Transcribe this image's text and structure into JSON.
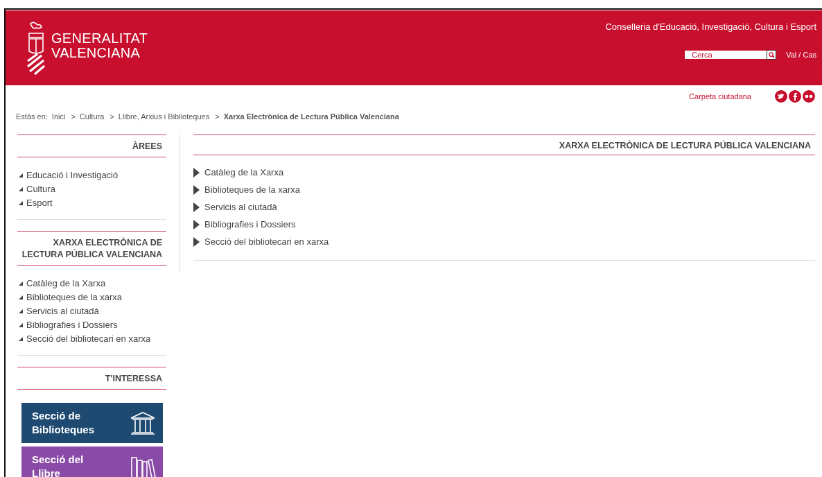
{
  "header": {
    "logo_line_1": "GENERALITAT",
    "logo_line_2": "VALENCIANA",
    "department": "Conselleria d'Educació, Investigació, Cultura i Esport",
    "search": {
      "placeholder": "Cerca"
    },
    "language": "Val / Cas"
  },
  "utility": {
    "link": "Carpeta ciutadana",
    "social": [
      {
        "kind": "twitter"
      },
      {
        "kind": "facebook"
      },
      {
        "kind": "flickr"
      }
    ]
  },
  "breadcrumb": {
    "label": "Estàs en:",
    "separator": ">",
    "items": [
      {
        "text": "Inici",
        "current": false
      },
      {
        "text": "Cultura",
        "current": false
      },
      {
        "text": "Llibre, Arxius i Biblioteques",
        "current": false
      },
      {
        "text": "Xarxa Electrònica de Lectura Pública Valenciana",
        "current": true
      }
    ]
  },
  "sidebar": {
    "sections": [
      {
        "title": "ÀREES",
        "items": [
          "Educació i Investigació",
          "Cultura",
          "Esport"
        ]
      },
      {
        "title": "XARXA ELECTRÒNICA DE LECTURA PÚBLICA VALENCIANA",
        "items": [
          "Catàleg de la Xarxa",
          "Biblioteques de la xarxa",
          "Servicis al ciutadà",
          "Bibliografies i Dossiers",
          "Secció del bibliotecari en xarxa"
        ]
      }
    ],
    "interest": {
      "title": "T'INTERESSA",
      "banners": [
        {
          "kind": "libraries",
          "line_1": "Secció de",
          "line_2": "Biblioteques",
          "color": "#1e4a72"
        },
        {
          "kind": "books",
          "line_1": "Secció del",
          "line_2": "Llibre",
          "color": "#8a4aa8"
        }
      ]
    }
  },
  "main": {
    "title": "XARXA ELECTRÒNICA DE LECTURA PÚBLICA VALENCIANA",
    "items": [
      "Catàleg de la Xarxa",
      "Biblioteques de la xarxa",
      "Servicis al ciutadà",
      "Bibliografies i Dossiers",
      "Secció del bibliotecari en xarxa"
    ]
  }
}
